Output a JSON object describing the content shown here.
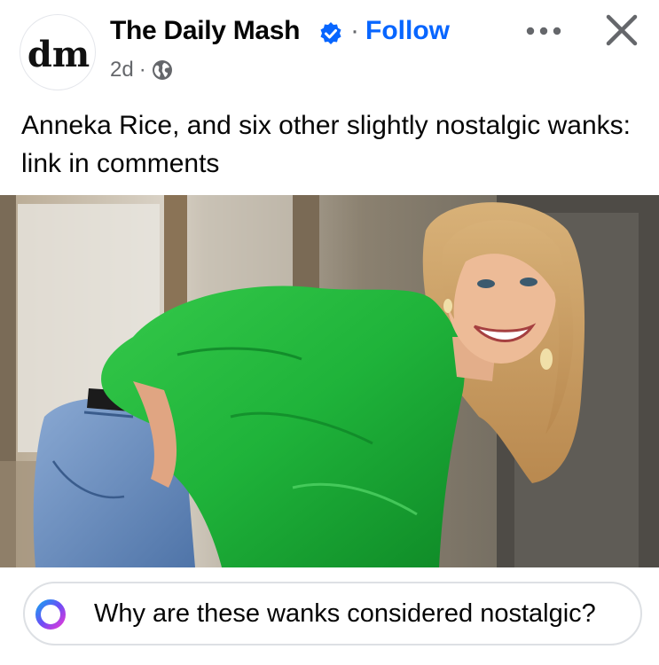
{
  "header": {
    "page_name": "The Daily Mash",
    "avatar_text": "dm",
    "follow_label": "Follow",
    "separator": "·",
    "timestamp": "2d",
    "audience_icon": "globe-icon",
    "verified_icon": "verified-badge-icon",
    "more_icon": "more-options-icon",
    "close_icon": "close-icon"
  },
  "post": {
    "text": "Anneka Rice, and six other slightly nostalgic wanks: link in comments"
  },
  "ai_prompt": {
    "icon": "meta-ai-ring-icon",
    "text": "Why are these wanks considered nostalgic?"
  },
  "colors": {
    "follow": "#0866ff",
    "verified": "#0866ff",
    "secondary_text": "#65676b",
    "shirt": "#1fb33a",
    "jeans": "#6a8fc0"
  }
}
